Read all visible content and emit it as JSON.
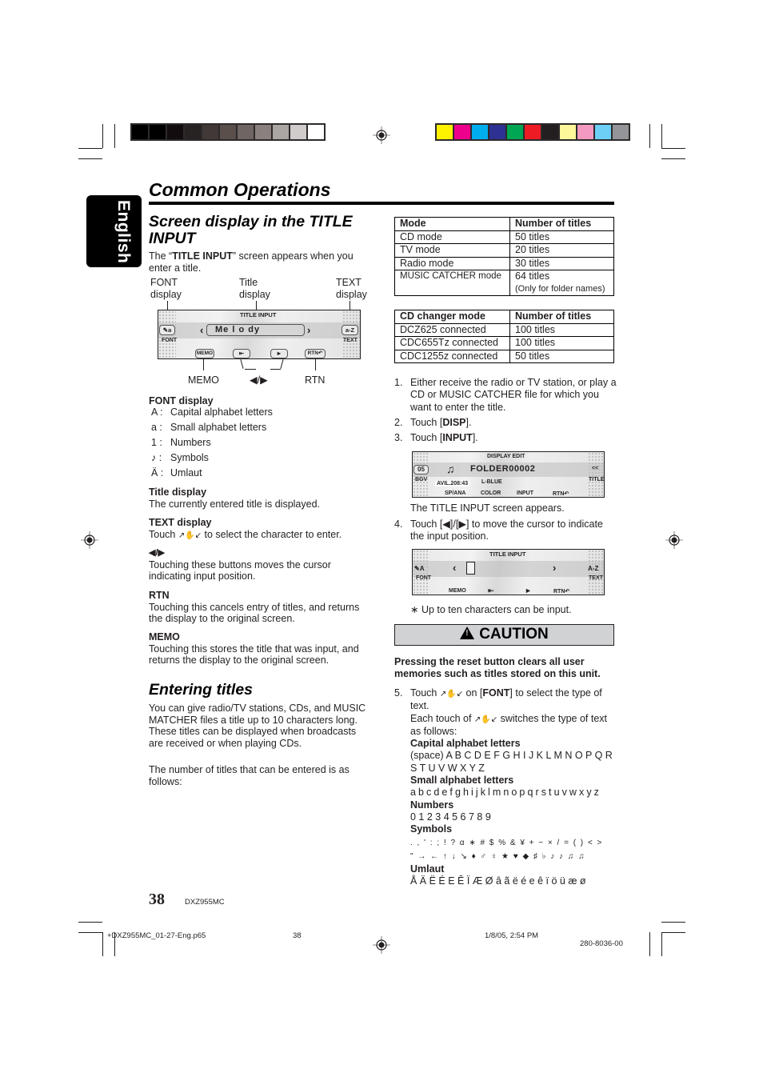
{
  "print_marks": {
    "gray_bar": [
      "#000000",
      "#000000",
      "#130c0e",
      "#272322",
      "#413837",
      "#5a4f4b",
      "#6f6563",
      "#8a817e",
      "#aba6a4",
      "#d0cccb",
      "#ffffff"
    ],
    "color_bar": [
      "#fff200",
      "#ec008c",
      "#00aeef",
      "#2e3192",
      "#00a651",
      "#ed1c24",
      "#231f20",
      "#fff799",
      "#f49ac1",
      "#6dcff6",
      "#939598"
    ]
  },
  "side_tab": {
    "label": "English"
  },
  "page": {
    "title": "Common Operations"
  },
  "section1": {
    "heading": "Screen display in the TITLE INPUT",
    "intro_pre": "The “",
    "intro_bold": "TITLE INPUT",
    "intro_post": "” screen appears when you enter a title.",
    "diagram": {
      "label_font": "FONT\ndisplay",
      "label_title": "Title\ndisplay",
      "label_text": "TEXT\ndisplay",
      "label_memo": "MEMO",
      "label_arrows": "◀/▶",
      "label_rtn": "RTN",
      "screen": {
        "header": "TITLE INPUT",
        "font_key": "a",
        "font_caption": "FONT",
        "title_value": "Me l o dy",
        "left_arrow": "‹",
        "right_arrow": "›",
        "text_key": "a-Z",
        "text_caption": "TEXT",
        "memo_key": "MEMO",
        "prev_key": "⇤",
        "next_key": "►",
        "rtn_key": "RTN↶"
      }
    },
    "font_display": {
      "heading": "FONT display",
      "items": [
        {
          "key": "A",
          "desc": "Capital alphabet letters"
        },
        {
          "key": "a",
          "desc": "Small alphabet letters"
        },
        {
          "key": "1",
          "desc": "Numbers"
        },
        {
          "key": "♪",
          "desc": "Symbols"
        },
        {
          "key": "Ä",
          "desc": "Umlaut"
        }
      ]
    },
    "title_display": {
      "heading": "Title display",
      "text": "The currently entered title is displayed."
    },
    "text_display": {
      "heading": "TEXT display",
      "text_pre": "Touch ",
      "glyph": "↗✋↙",
      "text_post": " to select the character to enter."
    },
    "arrows": {
      "heading": "◀/▶",
      "text": "Touching these buttons moves the cursor indicating input position."
    },
    "rtn": {
      "heading": "RTN",
      "text": "Touching this cancels entry of titles, and returns the display to the original screen."
    },
    "memo": {
      "heading": "MEMO",
      "text": "Touching this stores the title that was input, and returns the display to the original screen."
    }
  },
  "section2": {
    "heading": "Entering titles",
    "p1": "You can give radio/TV stations, CDs, and MUSIC MATCHER files a title up to 10 characters long. These titles can be displayed when broadcasts are received or when playing CDs.",
    "p2": "The number of titles that can be entered is as follows:"
  },
  "table_modes": {
    "headers": [
      "Mode",
      "Number of titles"
    ],
    "rows": [
      [
        "CD mode",
        "50 titles"
      ],
      [
        "TV mode",
        "20 titles"
      ],
      [
        "Radio mode",
        "30 titles"
      ],
      [
        "MUSIC CATCHER mode",
        "64 titles"
      ]
    ],
    "note": "(Only for folder names)"
  },
  "table_changer": {
    "headers": [
      "CD changer mode",
      "Number of titles"
    ],
    "rows": [
      [
        "DCZ625 connected",
        "100 titles"
      ],
      [
        "CDC655Tz connected",
        "100 titles"
      ],
      [
        "CDC1255z connected",
        "50 titles"
      ]
    ]
  },
  "steps": {
    "s1": {
      "n": "1.",
      "text": "Either receive the radio or TV station, or play a CD or MUSIC CATCHER file for which you want to enter the title."
    },
    "s2": {
      "n": "2.",
      "pre": "Touch [",
      "bold": "DISP",
      "post": "]."
    },
    "s3": {
      "n": "3.",
      "pre": "Touch [",
      "bold": "INPUT",
      "post": "]."
    },
    "display_edit_screen": {
      "header": "DISPLAY EDIT",
      "track": "05",
      "folder": "FOLDER00002",
      "back": "<<",
      "bgv": "BGV",
      "title_key": "TITLE",
      "avil": "AVIL.208:43",
      "color_value": "L-BLUE",
      "sp_ana": "SP/ANA",
      "color": "COLOR",
      "input": "INPUT",
      "rtn": "RTN↶"
    },
    "after3": "The TITLE INPUT screen appears.",
    "s4": {
      "n": "4.",
      "text": "Touch [◀]/[▶] to move the cursor to indicate the input position."
    },
    "title_input_screen": {
      "header": "TITLE INPUT",
      "font_key": "A",
      "font_caption": "FONT",
      "left_arrow": "‹",
      "right_arrow": "›",
      "text_key": "A-Z",
      "text_caption": "TEXT",
      "memo": "MEMO",
      "prev": "⇤",
      "next": "►",
      "rtn": "RTN↶"
    },
    "note": "∗  Up to ten characters can be input."
  },
  "caution": {
    "label": "CAUTION",
    "text": "Pressing the reset button clears all user memories such as titles stored on this unit."
  },
  "step5": {
    "n": "5.",
    "l1_pre": "Touch ",
    "glyph": "↗✋↙",
    "l1_mid": " on [",
    "l1_bold": "FONT",
    "l1_post": "] to select the type of text.",
    "l2_pre": "Each touch of ",
    "l2_post": " switches the type of text as follows:",
    "capital_heading": "Capital alphabet letters",
    "capital": "(space) A B C D E F G H I J K L M N O P Q R S T U V W X Y Z",
    "small_heading": "Small alphabet letters",
    "small": "a b c d e f g h i j k l m n o p q r s t u v w x y z",
    "numbers_heading": "Numbers",
    "numbers": "0 1 2 3 4 5 6 7 8 9",
    "symbols_heading": "Symbols",
    "symbols_line1": ". , ' : ; ! ? α ∗ # $ % & ¥ + − × / = ( ) < >",
    "symbols_line2": "\" → ← ↑ ↓ ↘ ♦ ♂ ♀ ★ ♥ ◆ ♯ ♭ ♪ ♪ ♫ ♫",
    "umlaut_heading": "Umlaut",
    "umlaut": "Å Ä Ë É E Ê Ï Æ Ø â ã ë é e ê ï ö ü æ ø"
  },
  "footer": {
    "page_number": "38",
    "model": "DXZ955MC",
    "file": "+DXZ955MC_01-27-Eng.p65",
    "file_page": "38",
    "date": "1/8/05, 2:54 PM",
    "code": "280-8036-00"
  }
}
